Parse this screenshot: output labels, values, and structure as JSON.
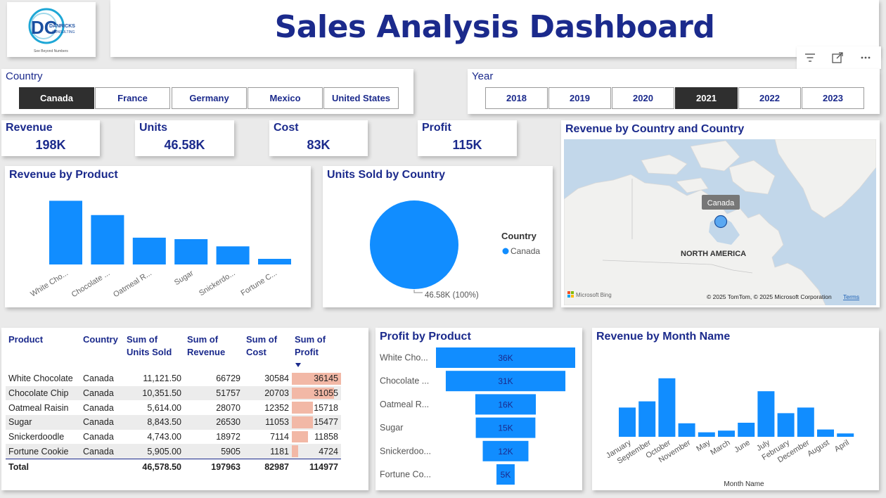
{
  "header": {
    "title": "Sales Analysis Dashboard",
    "logo": {
      "initials": "DC",
      "line1": "DANRICKS",
      "line2": "CONSULTING",
      "tagline": "See Beyond Numbers"
    }
  },
  "toolbar": {
    "icons": [
      "filter-icon",
      "expand-icon",
      "more-options-icon"
    ]
  },
  "country_slicer": {
    "title": "Country",
    "options": [
      {
        "label": "Canada",
        "selected": true
      },
      {
        "label": "France",
        "selected": false
      },
      {
        "label": "Germany",
        "selected": false
      },
      {
        "label": "Mexico",
        "selected": false
      },
      {
        "label": "United States",
        "selected": false
      }
    ]
  },
  "year_slicer": {
    "title": "Year",
    "options": [
      {
        "label": "2018",
        "selected": false
      },
      {
        "label": "2019",
        "selected": false
      },
      {
        "label": "2020",
        "selected": false
      },
      {
        "label": "2021",
        "selected": true
      },
      {
        "label": "2022",
        "selected": false
      },
      {
        "label": "2023",
        "selected": false
      }
    ]
  },
  "kpis": [
    {
      "label": "Revenue",
      "value": "198K"
    },
    {
      "label": "Units",
      "value": "46.58K"
    },
    {
      "label": "Cost",
      "value": "83K"
    },
    {
      "label": "Profit",
      "value": "115K"
    }
  ],
  "map": {
    "title": "Revenue by Country and Country",
    "region_label": "NORTH AMERICA",
    "bubble_label": "Canada",
    "bing_label": "Microsoft Bing",
    "copyright": "© 2025 TomTom, © 2025 Microsoft Corporation",
    "terms": "Terms"
  },
  "matrix": {
    "headers": [
      "Product",
      "Country",
      "Sum of Units Sold",
      "Sum of Revenue",
      "Sum of Cost",
      "Sum of Profit"
    ],
    "rows": [
      [
        "White Chocolate",
        "Canada",
        "11,121.50",
        "66729",
        "30584",
        "36145"
      ],
      [
        "Chocolate Chip",
        "Canada",
        "10,351.50",
        "51757",
        "20703",
        "31055"
      ],
      [
        "Oatmeal Raisin",
        "Canada",
        "5,614.00",
        "28070",
        "12352",
        "15718"
      ],
      [
        "Sugar",
        "Canada",
        "8,843.50",
        "26530",
        "11053",
        "15477"
      ],
      [
        "Snickerdoodle",
        "Canada",
        "4,743.00",
        "18972",
        "7114",
        "11858"
      ],
      [
        "Fortune Cookie",
        "Canada",
        "5,905.00",
        "5905",
        "1181",
        "4724"
      ]
    ],
    "profit_max": 36145,
    "total": [
      "Total",
      "",
      "46,578.50",
      "197963",
      "82987",
      "114977"
    ]
  },
  "colors": {
    "accent": "#118dff",
    "navy": "#1b2a8c",
    "profit_bar": "#f2b8a6",
    "selected": "#2f2f2f"
  },
  "chart_data": [
    {
      "id": "revenue_by_product",
      "type": "bar",
      "title": "Revenue by Product",
      "categories": [
        "White Cho...",
        "Chocolate ...",
        "Oatmeal R...",
        "Sugar",
        "Snickerdo...",
        "Fortune C..."
      ],
      "values": [
        66729,
        51757,
        28070,
        26530,
        18972,
        5905
      ],
      "ylim": [
        0,
        70000
      ],
      "grid": false
    },
    {
      "id": "units_sold_by_country",
      "type": "pie",
      "title": "Units Sold by Country",
      "legend_title": "Country",
      "legend_position": "right",
      "slices": [
        {
          "name": "Canada",
          "value": 46578.5,
          "label": "46.58K (100%)"
        }
      ]
    },
    {
      "id": "profit_by_product",
      "type": "bar",
      "orientation": "horizontal-funnel",
      "title": "Profit by Product",
      "categories": [
        "White Cho...",
        "Chocolate ...",
        "Oatmeal R...",
        "Sugar",
        "Snickerdoo...",
        "Fortune Co..."
      ],
      "values": [
        36145,
        31055,
        15718,
        15477,
        11858,
        4724
      ],
      "data_labels": [
        "36K",
        "31K",
        "16K",
        "15K",
        "12K",
        "5K"
      ]
    },
    {
      "id": "revenue_by_month",
      "type": "bar",
      "title": "Revenue by Month Name",
      "xlabel": "Month Name",
      "categories": [
        "January",
        "September",
        "October",
        "November",
        "May",
        "March",
        "June",
        "July",
        "February",
        "December",
        "August",
        "April"
      ],
      "values": [
        26000,
        31500,
        52000,
        12000,
        4000,
        5500,
        12500,
        40500,
        21000,
        26000,
        6500,
        3000
      ],
      "ylim": [
        0,
        55000
      ],
      "grid": false
    }
  ]
}
